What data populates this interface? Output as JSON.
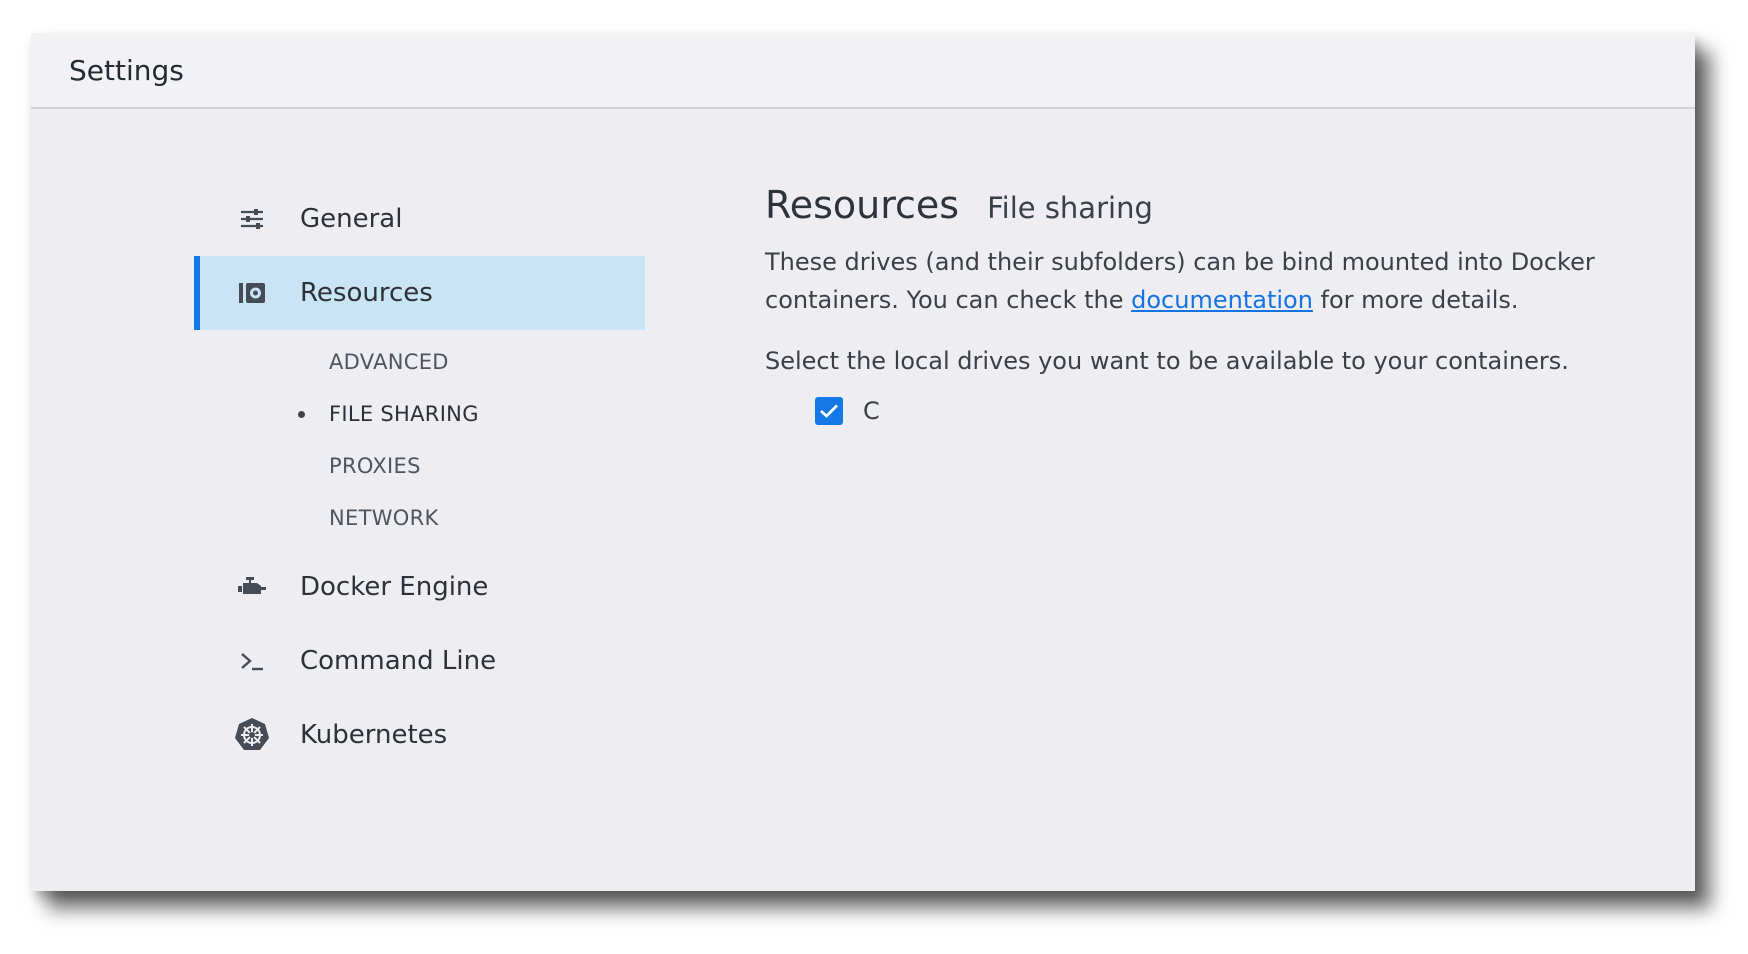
{
  "window": {
    "title": "Settings"
  },
  "sidebar": {
    "items": [
      {
        "label": "General",
        "icon": "sliders-icon"
      },
      {
        "label": "Resources",
        "icon": "disk-icon",
        "active": true,
        "subitems": [
          {
            "label": "ADVANCED"
          },
          {
            "label": "FILE SHARING",
            "selected": true
          },
          {
            "label": "PROXIES"
          },
          {
            "label": "NETWORK"
          }
        ]
      },
      {
        "label": "Docker Engine",
        "icon": "engine-icon"
      },
      {
        "label": "Command Line",
        "icon": "terminal-icon"
      },
      {
        "label": "Kubernetes",
        "icon": "kubernetes-icon"
      }
    ]
  },
  "main": {
    "title": "Resources",
    "subtitle": "File sharing",
    "description_before": "These drives (and their subfolders) can be bind mounted into Docker containers. You can check the ",
    "link_text": "documentation",
    "description_after": " for more details.",
    "select_text": "Select the local drives you want to be available to your containers.",
    "drives": [
      {
        "label": "C",
        "checked": true
      }
    ]
  },
  "colors": {
    "accent": "#1478e6",
    "active_bg": "#c8e4f5",
    "link": "#1573e1"
  }
}
